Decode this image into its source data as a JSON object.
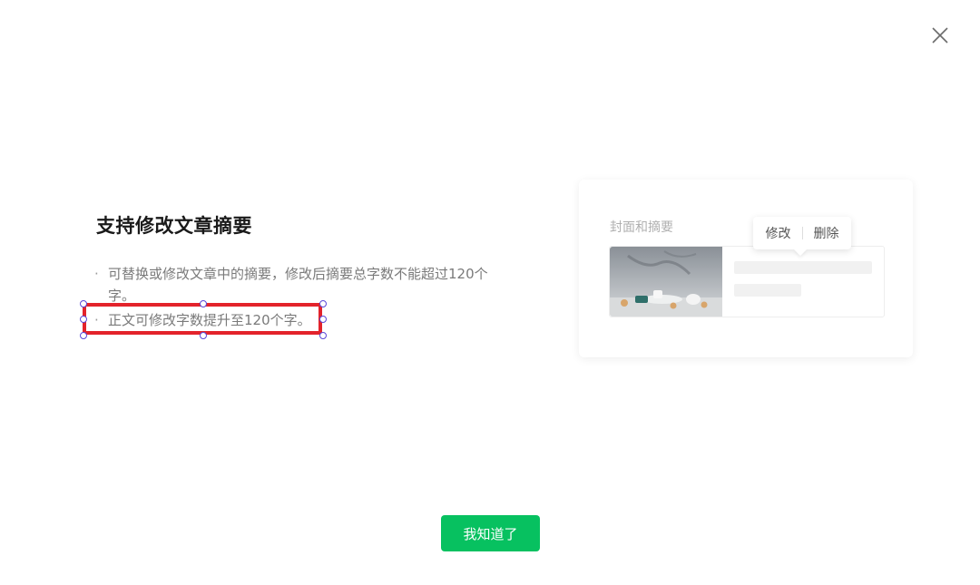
{
  "dialog": {
    "title": "支持修改文章摘要",
    "bullets": [
      "可替换或修改文章中的摘要，修改后摘要总字数不能超过120个字。",
      "正文可修改字数提升至120个字。"
    ],
    "bullet_symbol": "·",
    "close_icon": "close-icon",
    "confirm_label": "我知道了"
  },
  "preview": {
    "section_label": "封面和摘要",
    "popover": {
      "edit_label": "修改",
      "delete_label": "删除"
    }
  },
  "colors": {
    "primary": "#07c160",
    "selection_border": "#e3232b",
    "handle_border": "#5a49d8"
  }
}
